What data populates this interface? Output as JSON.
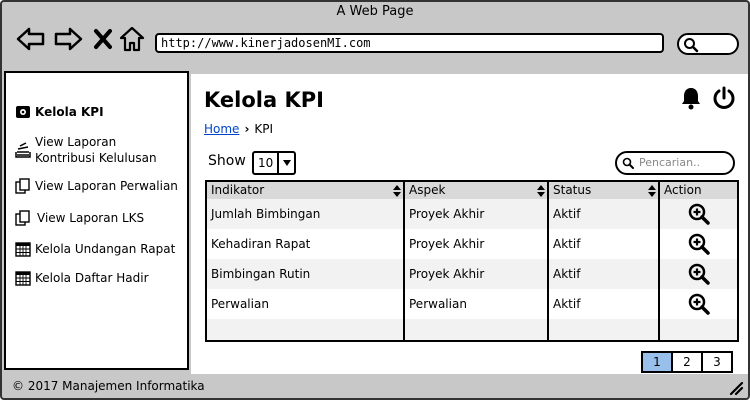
{
  "browser": {
    "title": "A Web Page",
    "url": "http://www.kinerjadosenMI.com"
  },
  "sidebar": {
    "items": [
      {
        "label": "Kelola KPI",
        "icon": "gear-icon",
        "active": true
      },
      {
        "label": "View Laporan\nKontribusi Kelulusan",
        "icon": "stack-icon",
        "active": false
      },
      {
        "label": "View Laporan Perwalian",
        "icon": "copy-icon",
        "active": false
      },
      {
        "label": "View Laporan LKS",
        "icon": "copy-icon",
        "active": false
      },
      {
        "label": "Kelola Undangan Rapat",
        "icon": "calendar-icon",
        "active": false
      },
      {
        "label": "Kelola Daftar Hadir",
        "icon": "calendar-icon",
        "active": false
      }
    ]
  },
  "main": {
    "title": "Kelola KPI",
    "breadcrumb": {
      "home": "Home",
      "current": "KPI"
    },
    "show_label": "Show",
    "show_value": "10",
    "search_placeholder": "Pencarian..",
    "table": {
      "headers": [
        "Indikator",
        "Aspek",
        "Status",
        "Action"
      ],
      "rows": [
        {
          "indikator": "Jumlah Bimbingan",
          "aspek": "Proyek Akhir",
          "status": "Aktif"
        },
        {
          "indikator": "Kehadiran Rapat",
          "aspek": "Proyek Akhir",
          "status": "Aktif"
        },
        {
          "indikator": "Bimbingan Rutin",
          "aspek": "Proyek Akhir",
          "status": "Aktif"
        },
        {
          "indikator": "Perwalian",
          "aspek": "Perwalian",
          "status": "Aktif"
        }
      ]
    },
    "pagination": {
      "pages": [
        "1",
        "2",
        "3"
      ],
      "current": "1"
    }
  },
  "footer": {
    "text": "© 2017 Manajemen Informatika"
  },
  "colors": {
    "chrome": "#c8c8c8",
    "link": "#0044cc",
    "page_active": "#99c0ea",
    "header_bg": "#d9d9d9"
  }
}
